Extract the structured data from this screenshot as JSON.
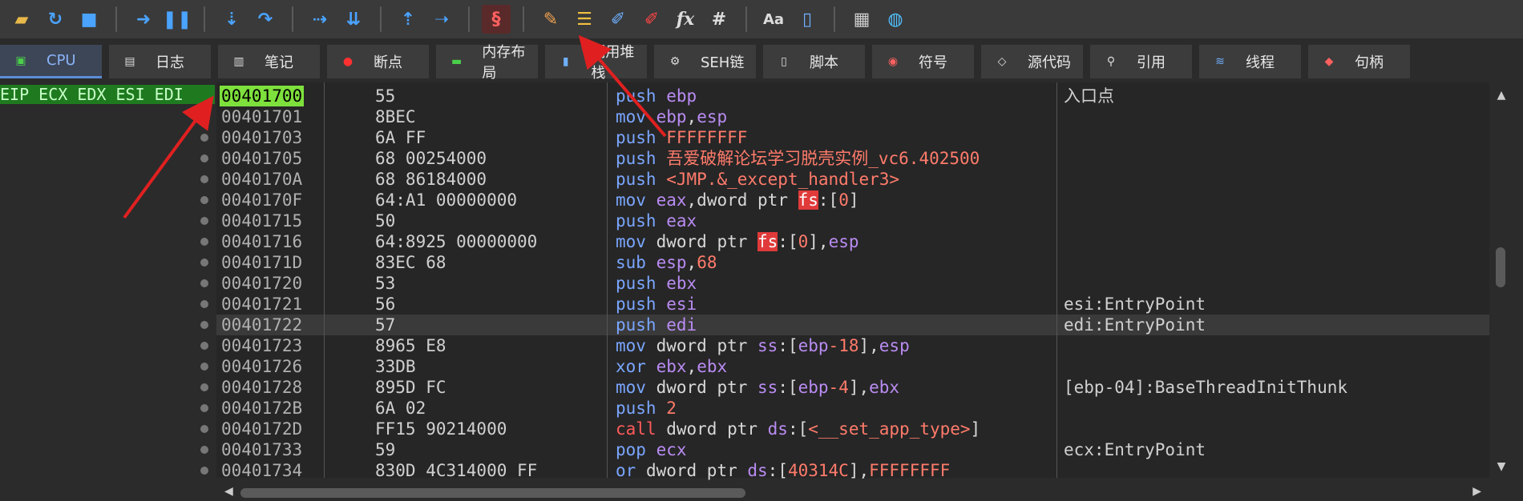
{
  "toolbar": {
    "icons": [
      "open-icon",
      "restart-icon",
      "stop-icon",
      "run-icon",
      "pause-icon",
      "step-into-icon",
      "step-over-icon",
      "animate-into-icon",
      "trace-icon",
      "execute-till-return-icon",
      "run-to-user-code-icon",
      "scylla-icon",
      "patch-icon",
      "comment-icon",
      "label-icon",
      "bookmark-icon",
      "function-icon",
      "hash-icon",
      "font-icon",
      "calculator-icon",
      "device-icon",
      "globe-icon"
    ],
    "glyphs": {
      "fx": "fx",
      "hash": "#",
      "font": "Aa"
    }
  },
  "tabs": [
    {
      "label": "CPU",
      "active": true
    },
    {
      "label": "日志"
    },
    {
      "label": "笔记"
    },
    {
      "label": "断点"
    },
    {
      "label": "内存布局"
    },
    {
      "label": "调用堆栈"
    },
    {
      "label": "SEH链"
    },
    {
      "label": "脚本"
    },
    {
      "label": "符号"
    },
    {
      "label": "源代码"
    },
    {
      "label": "引用"
    },
    {
      "label": "线程"
    },
    {
      "label": "句柄"
    }
  ],
  "registers_label": "EIP ECX EDX ESI EDI",
  "disasm": {
    "rows": [
      {
        "addr": "00401700",
        "bytes": "55",
        "instr": [
          [
            "op",
            "push"
          ],
          [
            "plain",
            " "
          ],
          [
            "reg",
            "ebp"
          ]
        ],
        "comment": "入口点",
        "eip": true
      },
      {
        "addr": "00401701",
        "bytes": "8BEC",
        "instr": [
          [
            "op",
            "mov"
          ],
          [
            "plain",
            " "
          ],
          [
            "reg",
            "ebp"
          ],
          [
            "plain",
            ","
          ],
          [
            "reg",
            "esp"
          ]
        ],
        "comment": ""
      },
      {
        "addr": "00401703",
        "bytes": "6A FF",
        "instr": [
          [
            "op",
            "push"
          ],
          [
            "plain",
            " "
          ],
          [
            "num",
            "FFFFFFFF"
          ]
        ],
        "comment": ""
      },
      {
        "addr": "00401705",
        "bytes": "68 00254000",
        "instr": [
          [
            "op",
            "push"
          ],
          [
            "plain",
            " "
          ],
          [
            "sym",
            "吾爱破解论坛学习脱壳实例_vc6.402500"
          ]
        ],
        "comment": ""
      },
      {
        "addr": "0040170A",
        "bytes": "68 86184000",
        "instr": [
          [
            "op",
            "push"
          ],
          [
            "plain",
            " "
          ],
          [
            "sym",
            "<JMP.&_except_handler3>"
          ]
        ],
        "comment": ""
      },
      {
        "addr": "0040170F",
        "bytes": "64:A1 00000000",
        "instr": [
          [
            "op",
            "mov"
          ],
          [
            "plain",
            " "
          ],
          [
            "reg",
            "eax"
          ],
          [
            "plain",
            ",dword ptr "
          ],
          [
            "seg",
            "fs"
          ],
          [
            "plain",
            ":["
          ],
          [
            "num",
            "0"
          ],
          [
            "plain",
            "]"
          ]
        ],
        "comment": ""
      },
      {
        "addr": "00401715",
        "bytes": "50",
        "instr": [
          [
            "op",
            "push"
          ],
          [
            "plain",
            " "
          ],
          [
            "reg",
            "eax"
          ]
        ],
        "comment": ""
      },
      {
        "addr": "00401716",
        "bytes": "64:8925 00000000",
        "instr": [
          [
            "op",
            "mov"
          ],
          [
            "plain",
            " dword ptr "
          ],
          [
            "seg",
            "fs"
          ],
          [
            "plain",
            ":["
          ],
          [
            "num",
            "0"
          ],
          [
            "plain",
            "],"
          ],
          [
            "reg",
            "esp"
          ]
        ],
        "comment": ""
      },
      {
        "addr": "0040171D",
        "bytes": "83EC 68",
        "instr": [
          [
            "op",
            "sub"
          ],
          [
            "plain",
            " "
          ],
          [
            "reg",
            "esp"
          ],
          [
            "plain",
            ","
          ],
          [
            "num",
            "68"
          ]
        ],
        "comment": ""
      },
      {
        "addr": "00401720",
        "bytes": "53",
        "instr": [
          [
            "op",
            "push"
          ],
          [
            "plain",
            " "
          ],
          [
            "reg",
            "ebx"
          ]
        ],
        "comment": ""
      },
      {
        "addr": "00401721",
        "bytes": "56",
        "instr": [
          [
            "op",
            "push"
          ],
          [
            "plain",
            " "
          ],
          [
            "reg",
            "esi"
          ]
        ],
        "comment": "esi:EntryPoint"
      },
      {
        "addr": "00401722",
        "bytes": "57",
        "instr": [
          [
            "op",
            "push"
          ],
          [
            "plain",
            " "
          ],
          [
            "reg",
            "edi"
          ]
        ],
        "comment": "edi:EntryPoint",
        "highlight": true
      },
      {
        "addr": "00401723",
        "bytes": "8965 E8",
        "instr": [
          [
            "op",
            "mov"
          ],
          [
            "plain",
            " dword ptr "
          ],
          [
            "reg",
            "ss"
          ],
          [
            "plain",
            ":["
          ],
          [
            "reg",
            "ebp"
          ],
          [
            "num",
            "-18"
          ],
          [
            "plain",
            "],"
          ],
          [
            "reg",
            "esp"
          ]
        ],
        "comment": ""
      },
      {
        "addr": "00401726",
        "bytes": "33DB",
        "instr": [
          [
            "op",
            "xor"
          ],
          [
            "plain",
            " "
          ],
          [
            "reg",
            "ebx"
          ],
          [
            "plain",
            ","
          ],
          [
            "reg",
            "ebx"
          ]
        ],
        "comment": ""
      },
      {
        "addr": "00401728",
        "bytes": "895D FC",
        "instr": [
          [
            "op",
            "mov"
          ],
          [
            "plain",
            " dword ptr "
          ],
          [
            "reg",
            "ss"
          ],
          [
            "plain",
            ":["
          ],
          [
            "reg",
            "ebp"
          ],
          [
            "num",
            "-4"
          ],
          [
            "plain",
            "],"
          ],
          [
            "reg",
            "ebx"
          ]
        ],
        "comment": "[ebp-04]:BaseThreadInitThunk"
      },
      {
        "addr": "0040172B",
        "bytes": "6A 02",
        "instr": [
          [
            "op",
            "push"
          ],
          [
            "plain",
            " "
          ],
          [
            "num",
            "2"
          ]
        ],
        "comment": ""
      },
      {
        "addr": "0040172D",
        "bytes": "FF15 90214000",
        "instr": [
          [
            "call",
            "call"
          ],
          [
            "plain",
            " dword ptr "
          ],
          [
            "reg",
            "ds"
          ],
          [
            "plain",
            ":["
          ],
          [
            "sym",
            "<__set_app_type>"
          ],
          [
            "plain",
            "]"
          ]
        ],
        "comment": ""
      },
      {
        "addr": "00401733",
        "bytes": "59",
        "instr": [
          [
            "op",
            "pop"
          ],
          [
            "plain",
            " "
          ],
          [
            "reg",
            "ecx"
          ]
        ],
        "comment": "ecx:EntryPoint"
      },
      {
        "addr": "00401734",
        "bytes": "830D 4C314000 FF",
        "instr": [
          [
            "op",
            "or"
          ],
          [
            "plain",
            " dword ptr "
          ],
          [
            "reg",
            "ds"
          ],
          [
            "plain",
            ":["
          ],
          [
            "num",
            "40314C"
          ],
          [
            "plain",
            "],"
          ],
          [
            "num",
            "FFFFFFFF"
          ]
        ],
        "comment": ""
      }
    ]
  }
}
